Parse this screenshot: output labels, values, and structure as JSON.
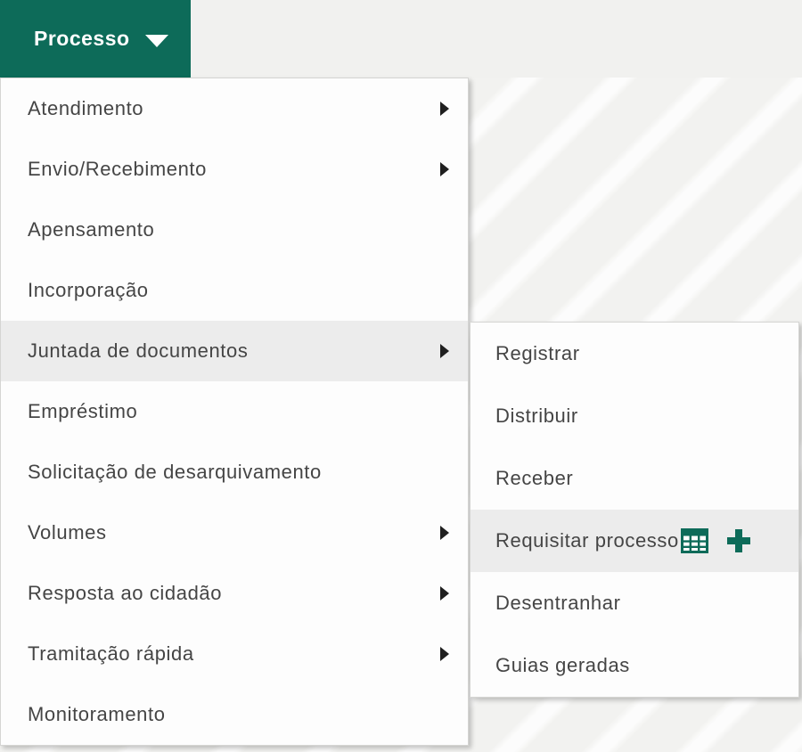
{
  "colors": {
    "teal": "#0d6b59",
    "highlight": "#ececec",
    "menu_text": "#454545",
    "panel_bg": "#fdfdfd"
  },
  "menu_button": {
    "label": "Processo",
    "caret_icon": "caret-down-icon"
  },
  "menu": {
    "items": [
      {
        "label": "Atendimento",
        "has_submenu": true,
        "highlighted": false
      },
      {
        "label": "Envio/Recebimento",
        "has_submenu": true,
        "highlighted": false
      },
      {
        "label": "Apensamento",
        "has_submenu": false,
        "highlighted": false
      },
      {
        "label": "Incorporação",
        "has_submenu": false,
        "highlighted": false
      },
      {
        "label": "Juntada de documentos",
        "has_submenu": true,
        "highlighted": true
      },
      {
        "label": "Empréstimo",
        "has_submenu": false,
        "highlighted": false
      },
      {
        "label": "Solicitação de desarquivamento",
        "has_submenu": false,
        "highlighted": false
      },
      {
        "label": "Volumes",
        "has_submenu": true,
        "highlighted": false
      },
      {
        "label": "Resposta ao cidadão",
        "has_submenu": true,
        "highlighted": false
      },
      {
        "label": "Tramitação rápida",
        "has_submenu": true,
        "highlighted": false
      },
      {
        "label": "Monitoramento",
        "has_submenu": false,
        "highlighted": false
      }
    ]
  },
  "submenu": {
    "parent": "Juntada de documentos",
    "items": [
      {
        "label": "Registrar",
        "highlighted": false,
        "icons": []
      },
      {
        "label": "Distribuir",
        "highlighted": false,
        "icons": []
      },
      {
        "label": "Receber",
        "highlighted": false,
        "icons": []
      },
      {
        "label": "Requisitar processo",
        "highlighted": true,
        "icons": [
          "table-icon",
          "plus-icon"
        ]
      },
      {
        "label": "Desentranhar",
        "highlighted": false,
        "icons": []
      },
      {
        "label": "Guias geradas",
        "highlighted": false,
        "icons": []
      }
    ]
  }
}
